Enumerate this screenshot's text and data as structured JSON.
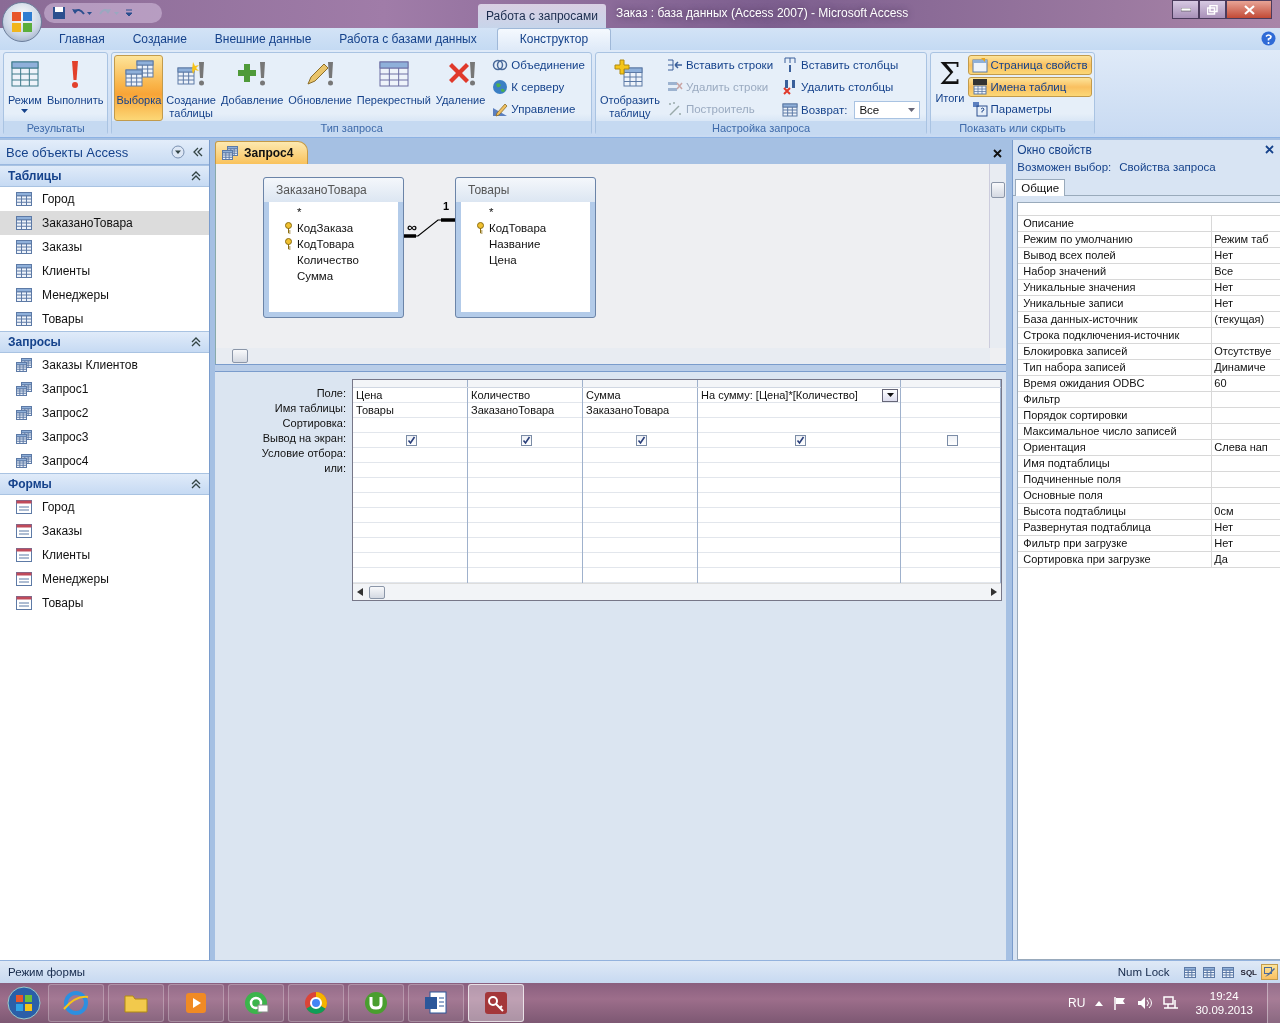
{
  "window": {
    "context_title": "Работа с запросами",
    "title": "Заказ : база данных (Access 2007)  -  Microsoft Access"
  },
  "ribbon_tabs": [
    {
      "label": "Главная",
      "selected": false
    },
    {
      "label": "Создание",
      "selected": false
    },
    {
      "label": "Внешние данные",
      "selected": false
    },
    {
      "label": "Работа с базами данных",
      "selected": false
    },
    {
      "label": "Конструктор",
      "selected": true
    }
  ],
  "ribbon_groups": [
    {
      "title": "Результаты",
      "items": [
        {
          "kind": "large",
          "label": "Режим",
          "dropdown": true,
          "selected": false,
          "disabled": false
        },
        {
          "kind": "large",
          "label": "Выполнить",
          "selected": false,
          "disabled": false
        }
      ]
    },
    {
      "title": "Тип запроса",
      "items": [
        {
          "kind": "large",
          "label": "Выборка",
          "selected": true,
          "disabled": false
        },
        {
          "kind": "large",
          "label": "Создание таблицы",
          "selected": false,
          "disabled": false
        },
        {
          "kind": "large",
          "label": "Добавление",
          "selected": false,
          "disabled": false
        },
        {
          "kind": "large",
          "label": "Обновление",
          "selected": false,
          "disabled": false
        },
        {
          "kind": "large",
          "label": "Перекрестный",
          "selected": false,
          "disabled": false
        },
        {
          "kind": "large",
          "label": "Удаление",
          "selected": false,
          "disabled": false
        },
        {
          "kind": "small",
          "label": "Объединение",
          "selected": false,
          "disabled": false
        },
        {
          "kind": "small",
          "label": "К серверу",
          "selected": false,
          "disabled": false
        },
        {
          "kind": "small",
          "label": "Управление",
          "selected": false,
          "disabled": false
        }
      ]
    },
    {
      "title": "Настройка запроса",
      "items": [
        {
          "kind": "large",
          "label": "Отобразить таблицу",
          "selected": false,
          "disabled": false
        },
        {
          "kind": "small",
          "label": "Вставить строки",
          "selected": false,
          "disabled": false
        },
        {
          "kind": "small",
          "label": "Удалить строки",
          "selected": false,
          "disabled": true
        },
        {
          "kind": "small",
          "label": "Построитель",
          "selected": false,
          "disabled": true
        },
        {
          "kind": "small",
          "label": "Вставить столбцы",
          "selected": false,
          "disabled": false
        },
        {
          "kind": "small",
          "label": "Удалить столбцы",
          "selected": false,
          "disabled": false
        },
        {
          "kind": "combo",
          "label": "Возврат:",
          "value": "Все"
        }
      ]
    },
    {
      "title": "Показать или скрыть",
      "items": [
        {
          "kind": "large",
          "label": "Итоги",
          "symbol": "Σ",
          "selected": false,
          "disabled": false
        },
        {
          "kind": "small",
          "label": "Страница свойств",
          "selected": true,
          "disabled": false
        },
        {
          "kind": "small",
          "label": "Имена таблиц",
          "selected": true,
          "disabled": false
        },
        {
          "kind": "small",
          "label": "Параметры",
          "selected": false,
          "disabled": false
        }
      ]
    }
  ],
  "navigation": {
    "title": "Все объекты Access",
    "groups": [
      {
        "title": "Таблицы",
        "kind": "table",
        "items": [
          {
            "label": "Город",
            "selected": false
          },
          {
            "label": "ЗаказаноТовара",
            "selected": true
          },
          {
            "label": "Заказы",
            "selected": false
          },
          {
            "label": "Клиенты",
            "selected": false
          },
          {
            "label": "Менеджеры",
            "selected": false
          },
          {
            "label": "Товары",
            "selected": false
          }
        ]
      },
      {
        "title": "Запросы",
        "kind": "query",
        "items": [
          {
            "label": "Заказы Клиентов",
            "selected": false
          },
          {
            "label": "Запрос1",
            "selected": false
          },
          {
            "label": "Запрос2",
            "selected": false
          },
          {
            "label": "Запрос3",
            "selected": false
          },
          {
            "label": "Запрос4",
            "selected": false
          }
        ]
      },
      {
        "title": "Формы",
        "kind": "form",
        "items": [
          {
            "label": "Город",
            "selected": false
          },
          {
            "label": "Заказы",
            "selected": false
          },
          {
            "label": "Клиенты",
            "selected": false
          },
          {
            "label": "Менеджеры",
            "selected": false
          },
          {
            "label": "Товары",
            "selected": false
          }
        ]
      }
    ]
  },
  "document_tab": {
    "label": "Запрос4"
  },
  "tables": [
    {
      "title": "ЗаказаноТовара",
      "fields": [
        {
          "name": "*",
          "key": false
        },
        {
          "name": "КодЗаказа",
          "key": true
        },
        {
          "name": "КодТовара",
          "key": true
        },
        {
          "name": "Количество",
          "key": false
        },
        {
          "name": "Сумма",
          "key": false
        }
      ]
    },
    {
      "title": "Товары",
      "fields": [
        {
          "name": "*",
          "key": false
        },
        {
          "name": "КодТовара",
          "key": true
        },
        {
          "name": "Название",
          "key": false
        },
        {
          "name": "Цена",
          "key": false
        }
      ]
    }
  ],
  "relationship": {
    "many_label": "∞",
    "one_label": "1"
  },
  "grid": {
    "row_labels": [
      "Поле:",
      "Имя таблицы:",
      "Сортировка:",
      "Вывод на экран:",
      "Условие отбора:",
      "или:"
    ],
    "columns": [
      {
        "field": "Цена",
        "table": "Товары",
        "show": true,
        "dropdown": false
      },
      {
        "field": "Количество",
        "table": "ЗаказаноТовара",
        "show": true,
        "dropdown": false
      },
      {
        "field": "Сумма",
        "table": "ЗаказаноТовара",
        "show": true,
        "dropdown": false
      },
      {
        "field": "На сумму: [Цена]*[Количество]",
        "show": true,
        "dropdown": true
      },
      {
        "show": false,
        "dropdown": false
      }
    ]
  },
  "property_sheet": {
    "title": "Окно свойств",
    "selection_label": "Возможен выбор:",
    "selection_value": "Свойства запроса",
    "tab": "Общие",
    "rows": [
      {
        "name": "Описание"
      },
      {
        "name": "Режим по умолчанию",
        "value": "Режим таб"
      },
      {
        "name": "Вывод всех полей",
        "value": "Нет"
      },
      {
        "name": "Набор значений",
        "value": "Все"
      },
      {
        "name": "Уникальные значения",
        "value": "Нет"
      },
      {
        "name": "Уникальные записи",
        "value": "Нет"
      },
      {
        "name": "База данных-источник",
        "value": "(текущая)"
      },
      {
        "name": "Строка подключения-источник"
      },
      {
        "name": "Блокировка записей",
        "value": "Отсутствуе"
      },
      {
        "name": "Тип набора записей",
        "value": "Динамиче"
      },
      {
        "name": "Время ожидания ODBC",
        "value": "60"
      },
      {
        "name": "Фильтр"
      },
      {
        "name": "Порядок сортировки"
      },
      {
        "name": "Максимальное число записей"
      },
      {
        "name": "Ориентация",
        "value": "Слева нап"
      },
      {
        "name": "Имя подтаблицы"
      },
      {
        "name": "Подчиненные поля"
      },
      {
        "name": "Основные поля"
      },
      {
        "name": "Высота подтаблицы",
        "value": "0см"
      },
      {
        "name": "Развернутая подтаблица",
        "value": "Нет"
      },
      {
        "name": "Фильтр при загрузке",
        "value": "Нет"
      },
      {
        "name": "Сортировка при загрузке",
        "value": "Да"
      }
    ]
  },
  "status_bar": {
    "left": "Режим формы",
    "right": "Num Lock",
    "views": [
      {
        "selected": false
      },
      {
        "selected": false
      },
      {
        "selected": false
      },
      {
        "text": "SQL",
        "selected": false
      },
      {
        "selected": true
      }
    ]
  },
  "taskbar": {
    "apps": [
      {
        "selected": false
      },
      {
        "selected": false
      },
      {
        "selected": false
      },
      {
        "selected": false
      },
      {
        "selected": false
      },
      {
        "selected": false
      },
      {
        "selected": false
      },
      {
        "selected": true
      }
    ],
    "language": "RU",
    "time": "19:24",
    "date": "30.09.2013"
  }
}
